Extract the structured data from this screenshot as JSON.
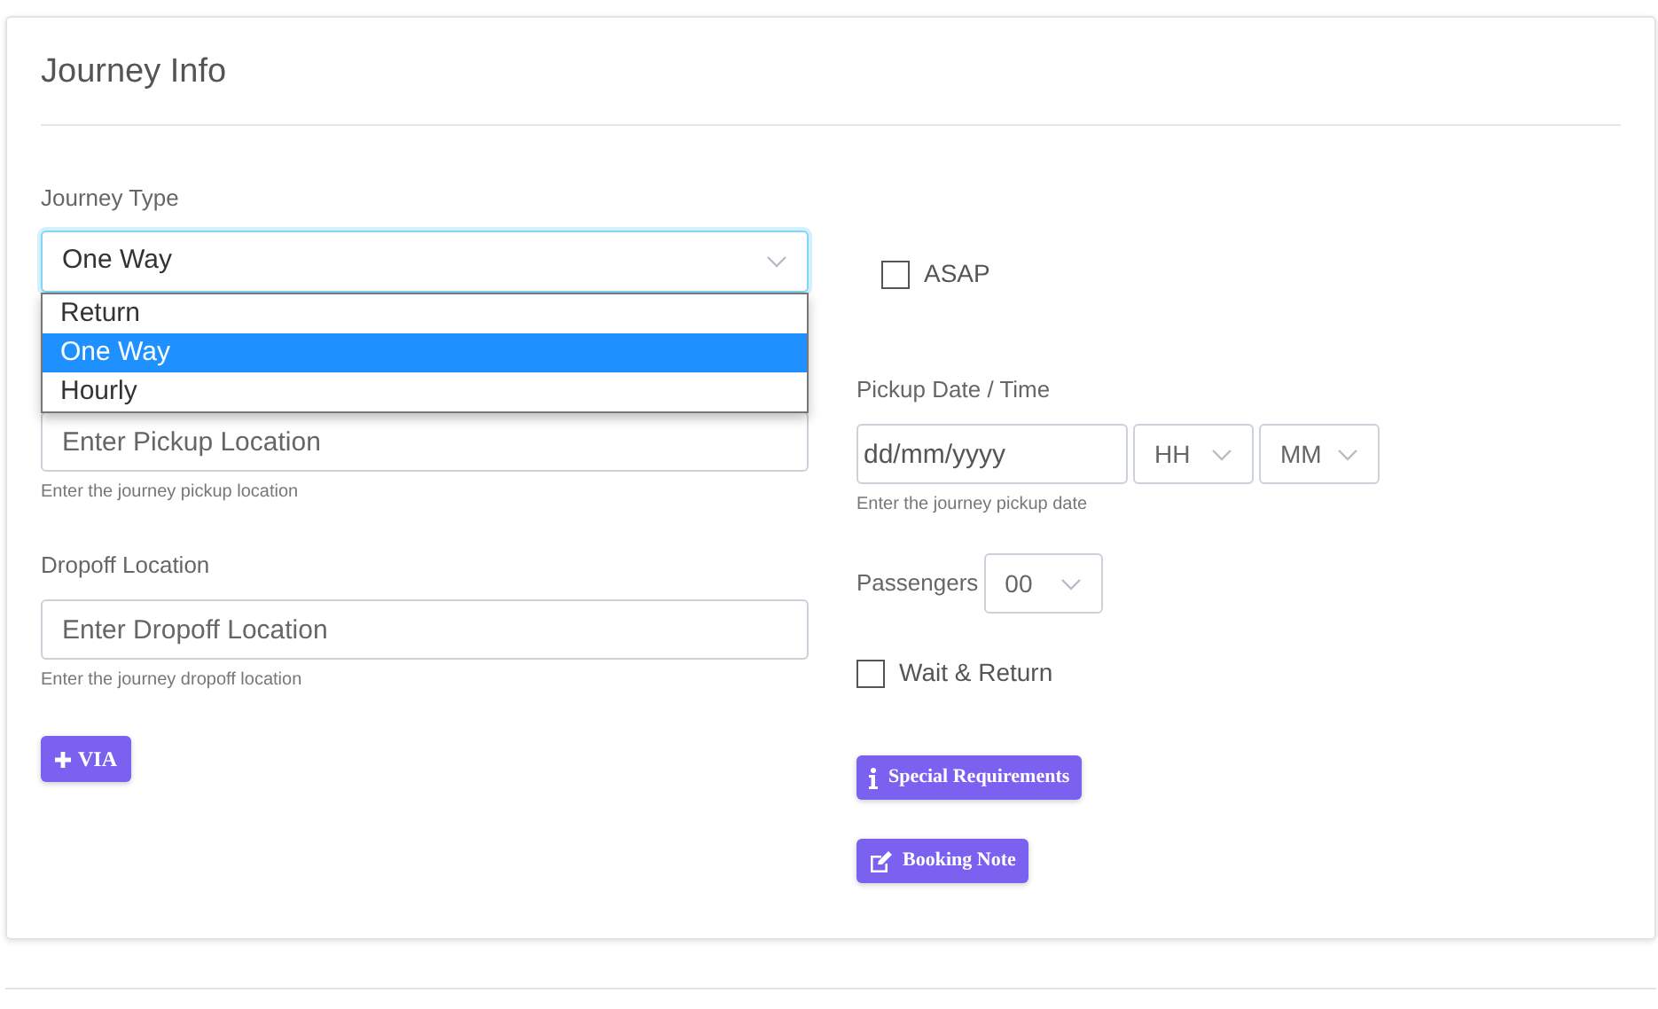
{
  "title": "Journey Info",
  "journey_type": {
    "label": "Journey Type",
    "value": "One Way",
    "expanded": true,
    "options": [
      {
        "label": "Return",
        "selected": false
      },
      {
        "label": "One Way",
        "selected": true
      },
      {
        "label": "Hourly",
        "selected": false
      }
    ]
  },
  "pickup_location": {
    "placeholder": "Enter Pickup Location",
    "help": "Enter the journey pickup location"
  },
  "dropoff_location": {
    "label": "Dropoff Location",
    "placeholder": "Enter Dropoff Location",
    "help": "Enter the journey dropoff location"
  },
  "via_button": "VIA",
  "asap": {
    "label": "ASAP",
    "checked": false
  },
  "pickup_datetime": {
    "label": "Pickup Date / Time",
    "date_placeholder": "dd/mm/yyyy",
    "hour": "HH",
    "minute": "MM",
    "help": "Enter the journey pickup date"
  },
  "passengers": {
    "label": "Passengers",
    "value": "00"
  },
  "wait_and_return": {
    "label": "Wait & Return",
    "checked": false
  },
  "buttons": [
    {
      "kind": "info",
      "label": "Special Requirements"
    },
    {
      "kind": "note",
      "label": "Booking Note"
    }
  ]
}
